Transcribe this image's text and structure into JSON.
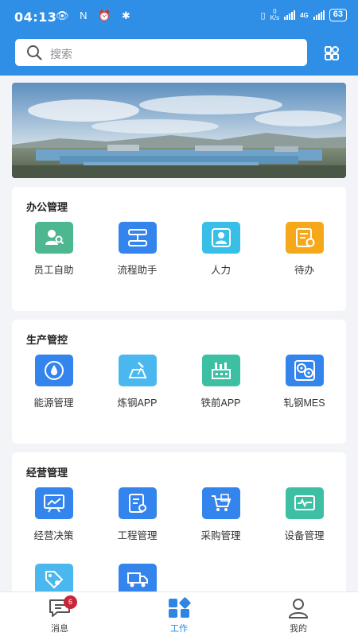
{
  "status_bar": {
    "time": "04:13",
    "net_speed": "0",
    "net_unit": "K/s",
    "network": "4G",
    "battery": "63"
  },
  "search": {
    "placeholder": "搜索"
  },
  "sections": [
    {
      "title": "办公管理",
      "items": [
        {
          "label": "员工自助",
          "icon": "employee-key-icon",
          "color": "#4db890"
        },
        {
          "label": "流程助手",
          "icon": "flowchart-icon",
          "color": "#3384ec"
        },
        {
          "label": "人力",
          "icon": "person-id-icon",
          "color": "#37bfe7"
        },
        {
          "label": "待办",
          "icon": "todo-list-icon",
          "color": "#f5a91a"
        }
      ]
    },
    {
      "title": "生产管控",
      "items": [
        {
          "label": "能源管理",
          "icon": "energy-drop-icon",
          "color": "#3384ec"
        },
        {
          "label": "炼钢APP",
          "icon": "steel-pour-icon",
          "color": "#4ab8ee"
        },
        {
          "label": "铁前APP",
          "icon": "factory-icon",
          "color": "#3cbfa3"
        },
        {
          "label": "轧钢MES",
          "icon": "rolling-mill-icon",
          "color": "#3384ec"
        }
      ]
    },
    {
      "title": "经营管理",
      "items": [
        {
          "label": "经营决策",
          "icon": "trend-board-icon",
          "color": "#3384ec"
        },
        {
          "label": "工程管理",
          "icon": "engineering-doc-icon",
          "color": "#3384ec"
        },
        {
          "label": "采购管理",
          "icon": "shopping-cart-icon",
          "color": "#3384ec"
        },
        {
          "label": "设备管理",
          "icon": "equipment-monitor-icon",
          "color": "#3cbfa3"
        },
        {
          "label": "",
          "icon": "price-tag-gear-icon",
          "color": "#4ab8ee"
        },
        {
          "label": "",
          "icon": "delivery-truck-icon",
          "color": "#3384ec"
        }
      ]
    }
  ],
  "bottom_nav": [
    {
      "label": "消息",
      "icon": "message-icon",
      "badge": "6"
    },
    {
      "label": "工作",
      "icon": "work-apps-icon",
      "active": true
    },
    {
      "label": "我的",
      "icon": "user-icon"
    }
  ],
  "accent_color": "#2f8fe6"
}
